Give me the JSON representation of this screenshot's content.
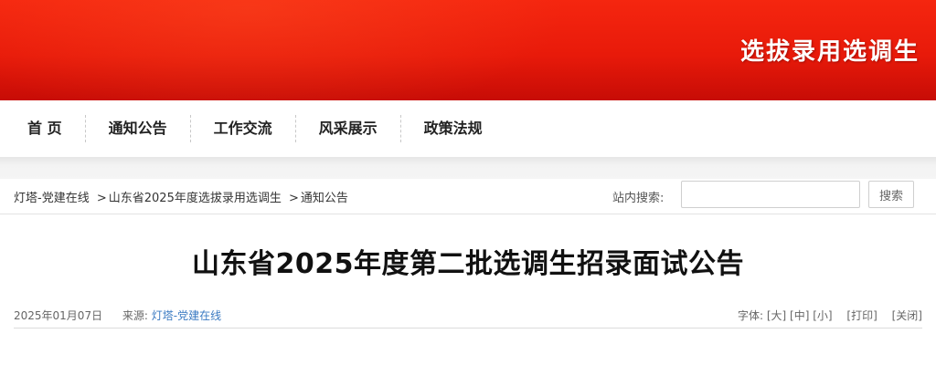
{
  "banner": {
    "title": "选拔录用选调生"
  },
  "nav": {
    "items": [
      {
        "label": "首 页"
      },
      {
        "label": "通知公告"
      },
      {
        "label": "工作交流"
      },
      {
        "label": "风采展示"
      },
      {
        "label": "政策法规"
      }
    ]
  },
  "breadcrumb": {
    "items": [
      "灯塔-党建在线",
      "山东省2025年度选拔录用选调生",
      "通知公告"
    ],
    "separator": ">"
  },
  "search": {
    "label": "站内搜索:",
    "value": "",
    "placeholder": "",
    "button_label": "搜索"
  },
  "article": {
    "title": "山东省2025年度第二批选调生招录面试公告",
    "date": "2025年01月07日",
    "source_label": "来源:",
    "source_name": "灯塔-党建在线",
    "font_label": "字体:",
    "font_large": "[大]",
    "font_medium": "[中]",
    "font_small": "[小]",
    "print_label": "[打印]",
    "close_label": "[关闭]"
  }
}
